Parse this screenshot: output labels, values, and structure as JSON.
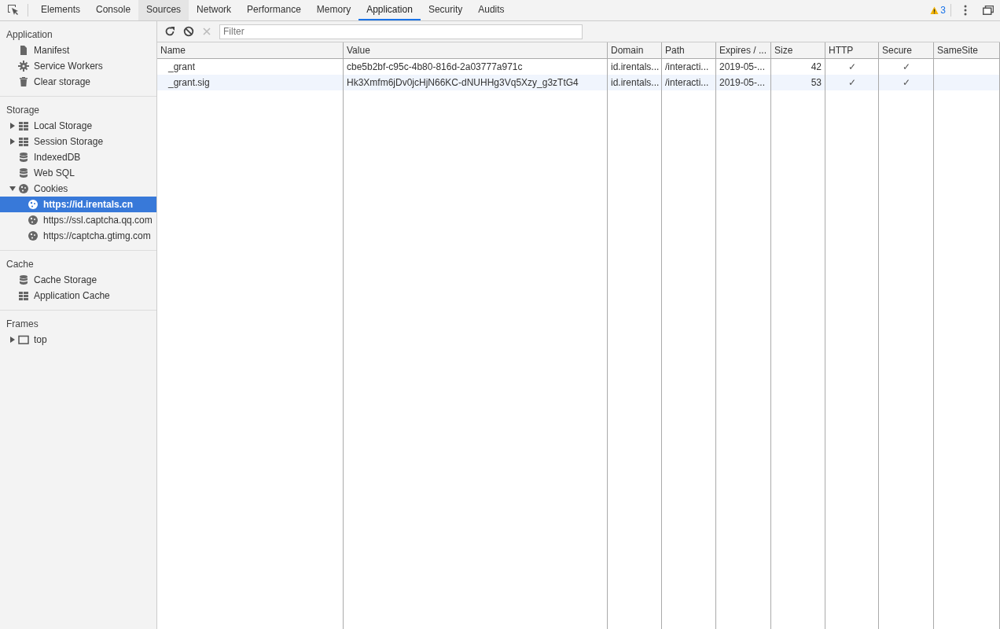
{
  "tabs": [
    {
      "label": "Elements",
      "selected": false,
      "hovered": false
    },
    {
      "label": "Console",
      "selected": false,
      "hovered": false
    },
    {
      "label": "Sources",
      "selected": false,
      "hovered": true
    },
    {
      "label": "Network",
      "selected": false,
      "hovered": false
    },
    {
      "label": "Performance",
      "selected": false,
      "hovered": false
    },
    {
      "label": "Memory",
      "selected": false,
      "hovered": false
    },
    {
      "label": "Application",
      "selected": true,
      "hovered": false
    },
    {
      "label": "Security",
      "selected": false,
      "hovered": false
    },
    {
      "label": "Audits",
      "selected": false,
      "hovered": false
    }
  ],
  "warnings": {
    "count": "3"
  },
  "sidebar": {
    "sections": [
      {
        "title": "Application",
        "items": [
          {
            "label": "Manifest",
            "kind": "file",
            "selected": false
          },
          {
            "label": "Service Workers",
            "kind": "gear",
            "selected": false
          },
          {
            "label": "Clear storage",
            "kind": "trash",
            "selected": false
          }
        ]
      },
      {
        "title": "Storage",
        "items": [
          {
            "label": "Local Storage",
            "kind": "grid",
            "selected": false,
            "expanded": false
          },
          {
            "label": "Session Storage",
            "kind": "grid",
            "selected": false,
            "expanded": false
          },
          {
            "label": "IndexedDB",
            "kind": "database",
            "selected": false
          },
          {
            "label": "Web SQL",
            "kind": "database",
            "selected": false
          },
          {
            "label": "Cookies",
            "kind": "cookie",
            "selected": false,
            "expanded": true,
            "children": [
              {
                "label": "https://id.irentals.cn",
                "kind": "cookie",
                "selected": true
              },
              {
                "label": "https://ssl.captcha.qq.com",
                "kind": "cookie",
                "selected": false
              },
              {
                "label": "https://captcha.gtimg.com",
                "kind": "cookie",
                "selected": false
              }
            ]
          }
        ]
      },
      {
        "title": "Cache",
        "items": [
          {
            "label": "Cache Storage",
            "kind": "database",
            "selected": false
          },
          {
            "label": "Application Cache",
            "kind": "grid",
            "selected": false
          }
        ]
      },
      {
        "title": "Frames",
        "items": [
          {
            "label": "top",
            "kind": "frame",
            "selected": false,
            "expanded": false
          }
        ]
      }
    ]
  },
  "filter": {
    "placeholder": "Filter"
  },
  "table": {
    "columns": [
      {
        "label": "Name",
        "kind": "text"
      },
      {
        "label": "Value",
        "kind": "text"
      },
      {
        "label": "Domain",
        "kind": "text"
      },
      {
        "label": "Path",
        "kind": "text"
      },
      {
        "label": "Expires / ...",
        "kind": "text"
      },
      {
        "label": "Size",
        "kind": "number"
      },
      {
        "label": "HTTP",
        "kind": "flag"
      },
      {
        "label": "Secure",
        "kind": "flag"
      },
      {
        "label": "SameSite",
        "kind": "text"
      }
    ],
    "rows": [
      {
        "cells": [
          "_grant",
          "cbe5b2bf-c95c-4b80-816d-2a03777a971c",
          "id.irentals...",
          "/interacti...",
          "2019-05-...",
          "42",
          "✓",
          "✓",
          ""
        ]
      },
      {
        "cells": [
          "_grant.sig",
          "Hk3Xmfm6jDv0jcHjN66KC-dNUHHg3Vq5Xzy_g3zTtG4",
          "id.irentals...",
          "/interacti...",
          "2019-05-...",
          "53",
          "✓",
          "✓",
          ""
        ]
      }
    ]
  }
}
